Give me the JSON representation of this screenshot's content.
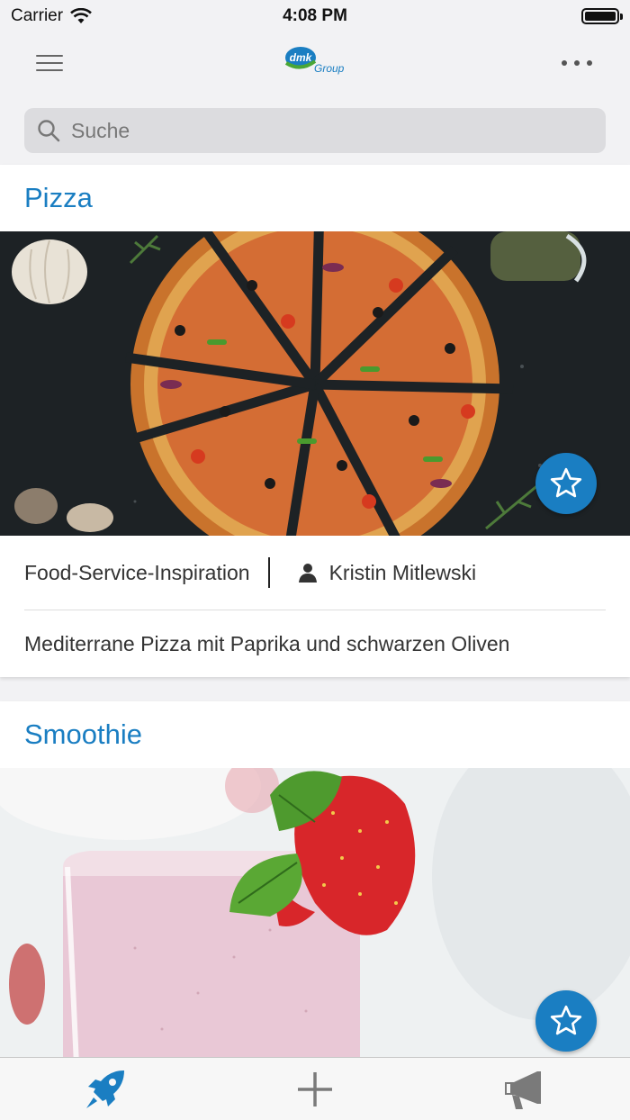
{
  "status_bar": {
    "carrier": "Carrier",
    "time": "4:08 PM"
  },
  "nav": {
    "menu_icon": "hamburger-icon",
    "logo": {
      "brand": "dmk",
      "suffix": "Group",
      "color": "#1a7ec2"
    },
    "more_icon": "ellipsis-icon"
  },
  "search": {
    "placeholder": "Suche",
    "value": "",
    "icon": "search-icon"
  },
  "cards": [
    {
      "title": "Pizza",
      "image": "pizza-photo",
      "category": "Food-Service-Inspiration",
      "author": "Kristin Mitlewski",
      "description": "Mediterrane Pizza mit Paprika und schwarzen Oliven",
      "favorite_icon": "star-outline-icon"
    },
    {
      "title": "Smoothie",
      "image": "smoothie-photo",
      "favorite_icon": "star-outline-icon"
    }
  ],
  "tab_bar": {
    "tabs": [
      {
        "icon": "rocket-icon",
        "active": true
      },
      {
        "icon": "plus-icon",
        "active": false
      },
      {
        "icon": "megaphone-icon",
        "active": false
      }
    ]
  },
  "colors": {
    "accent": "#1a7ec2",
    "inactive": "#7a7a7a",
    "background": "#f2f2f4"
  }
}
